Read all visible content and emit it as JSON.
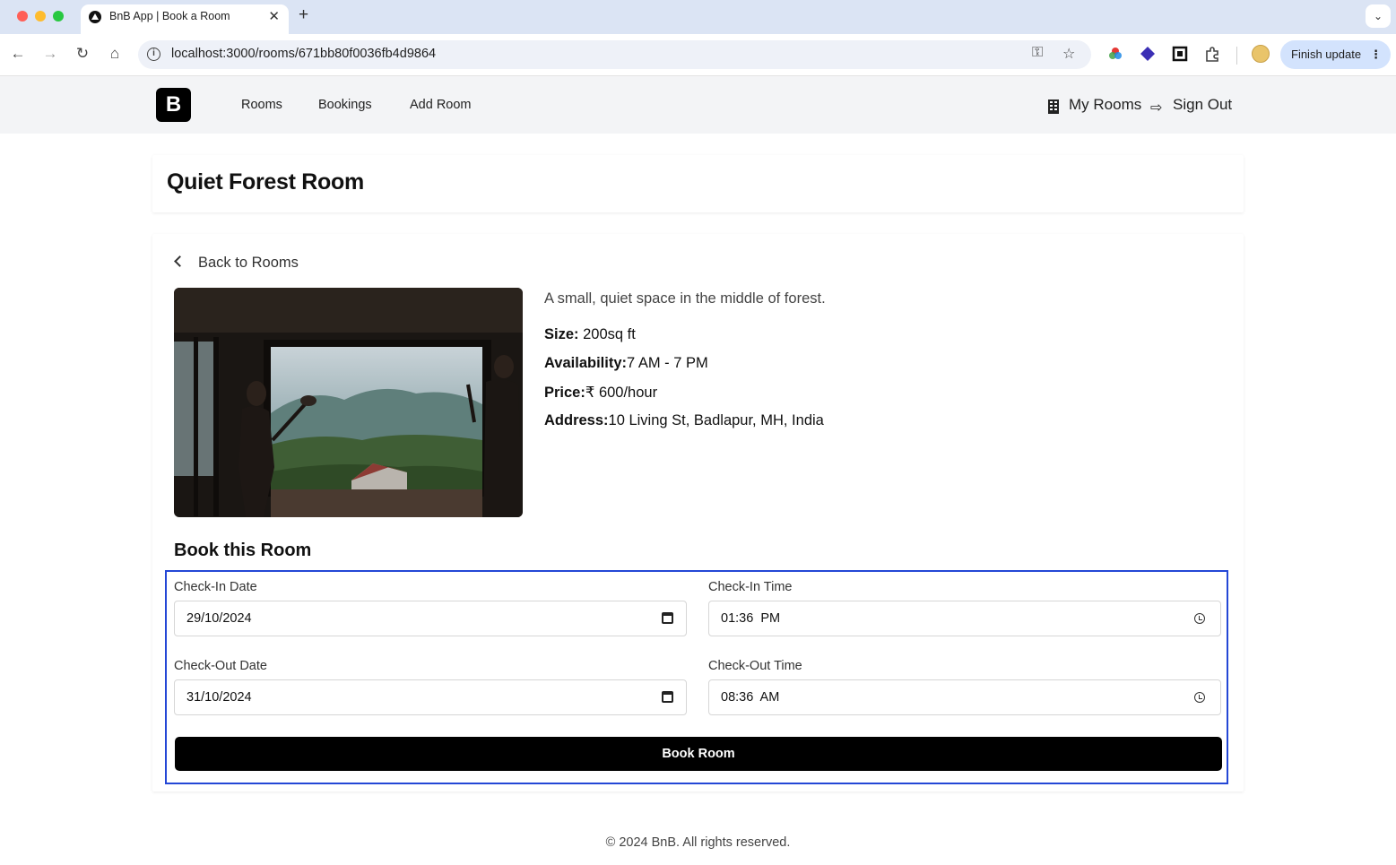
{
  "browser": {
    "tab_title": "BnB App | Book a Room",
    "url": "localhost:3000/rooms/671bb80f0036fb4d9864",
    "finish_update": "Finish update"
  },
  "nav": {
    "logo": "B",
    "links": [
      "Rooms",
      "Bookings",
      "Add Room"
    ],
    "my_rooms": "My Rooms",
    "sign_out": "Sign Out"
  },
  "room": {
    "title": "Quiet Forest Room",
    "back_label": "Back to Rooms",
    "description": "A small, quiet space in the middle of forest.",
    "size_label": "Size:",
    "size_value": " 200sq ft",
    "availability_label": "Availability:",
    "availability_value": "7 AM - 7 PM",
    "price_label": "Price:",
    "price_value": "₹ 600/hour",
    "address_label": "Address:",
    "address_value": "10 Living St, Badlapur, MH, India"
  },
  "booking": {
    "title": "Book this Room",
    "checkin_date_label": "Check-In Date",
    "checkin_date": "29/10/2024",
    "checkin_time_label": "Check-In Time",
    "checkin_time": "01:36  PM",
    "checkout_date_label": "Check-Out Date",
    "checkout_date": "31/10/2024",
    "checkout_time_label": "Check-Out Time",
    "checkout_time": "08:36  AM",
    "submit_label": "Book Room"
  },
  "footer": "© 2024 BnB. All rights reserved."
}
